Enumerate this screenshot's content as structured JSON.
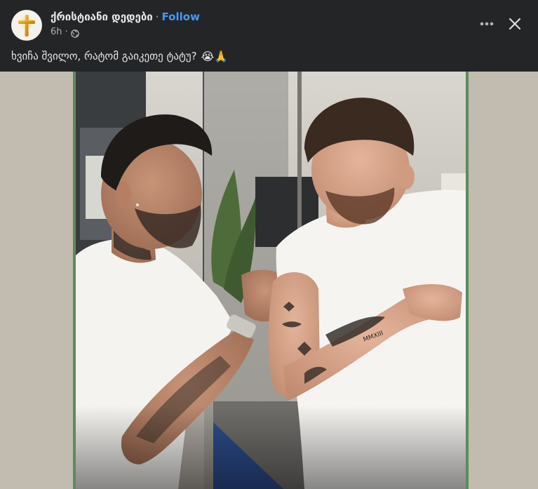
{
  "post": {
    "author": "ქრისტიანი დედები",
    "separator": "·",
    "follow_label": "Follow",
    "time": "6h",
    "meta_separator": "·",
    "audience_icon": "globe-icon",
    "caption": "ხვიჩა შვილო, რატომ გაიკეთე ტატუ?",
    "caption_emojis": "😭🙏"
  },
  "icons": {
    "more": "more-horizontal-icon",
    "close": "close-icon",
    "avatar": "golden-cross-avatar"
  },
  "colors": {
    "background": "#242526",
    "text_primary": "#e4e6eb",
    "text_secondary": "#b0b3b8",
    "link": "#4599ff",
    "media_backdrop": "#c2bbaf",
    "photo_border": "#5e8a60"
  }
}
